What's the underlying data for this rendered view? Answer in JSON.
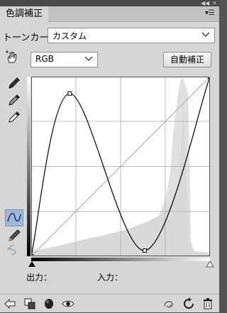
{
  "panel": {
    "tab_title": "色調補正",
    "preset_label": "トーンカーブ",
    "preset_value": "カスタム",
    "channel_value": "RGB",
    "auto_button": "自動補正",
    "output_label": "出力：",
    "input_label": "入力："
  },
  "curve": {
    "type": "curve",
    "axis_range": [
      0,
      255
    ],
    "control_points": [
      [
        0,
        0
      ],
      [
        55,
        231
      ],
      [
        162,
        8
      ],
      [
        255,
        255
      ]
    ],
    "grid_divisions": 4,
    "baseline": "diagonal"
  },
  "icons": {
    "tab_menu": "panel-menu-icon",
    "collapse": "collapse-arrows-icon",
    "close": "close-icon"
  },
  "colors": {
    "panel_bg": "#d6d6d6",
    "graph_bg": "#ffffff",
    "histogram": "#e0e0e0",
    "curve": "#000000"
  }
}
